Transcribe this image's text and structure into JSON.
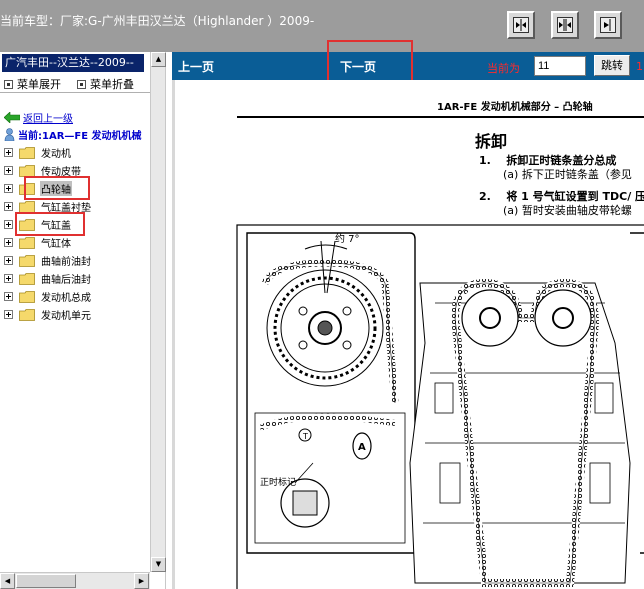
{
  "header": {
    "car_title": "当前车型：厂家:G-广州丰田汉兰达（Highlander ）2009-",
    "buttons": [
      "first-page",
      "split-view",
      "last-page"
    ]
  },
  "sidebar": {
    "model": "广汽丰田--汉兰达--2009--",
    "expand_menu": "菜单展开",
    "collapse_menu": "菜单折叠",
    "back_link": "返回上一级",
    "current": "当前:1AR—FE 发动机机械",
    "items": [
      {
        "label": "发动机"
      },
      {
        "label": "传动皮带"
      },
      {
        "label": "凸轮轴"
      },
      {
        "label": "气缸盖衬垫"
      },
      {
        "label": "气缸盖"
      },
      {
        "label": "气缸体"
      },
      {
        "label": "曲轴前油封"
      },
      {
        "label": "曲轴后油封"
      },
      {
        "label": "发动机总成"
      },
      {
        "label": "发动机单元"
      }
    ]
  },
  "nav": {
    "prev_page": "上一页",
    "next_page": "下一页",
    "current_label": "当前为",
    "current_page": "11",
    "jump_button": "跳转",
    "extra": "1"
  },
  "document": {
    "section_header": "1AR-FE 发动机机械部分 – 凸轮轴",
    "heading": "拆卸",
    "steps": [
      {
        "num": "1.",
        "title": "拆卸正时链条盖分总成",
        "sub": "(a)   拆下正时链条盖（参见"
      },
      {
        "num": "2.",
        "title": "将 1 号气缸设置到 TDC/ 压",
        "sub": "(a)   暂时安装曲轴皮带轮螺"
      }
    ],
    "figure": {
      "angle_label": "约 7°",
      "mark_label": "正时标记",
      "callout_a": "A"
    }
  },
  "colors": {
    "nav_bar": "#0a5d96",
    "header_bg": "#9c9c9c",
    "highlight_box": "#e03030",
    "link": "#0000cc"
  }
}
